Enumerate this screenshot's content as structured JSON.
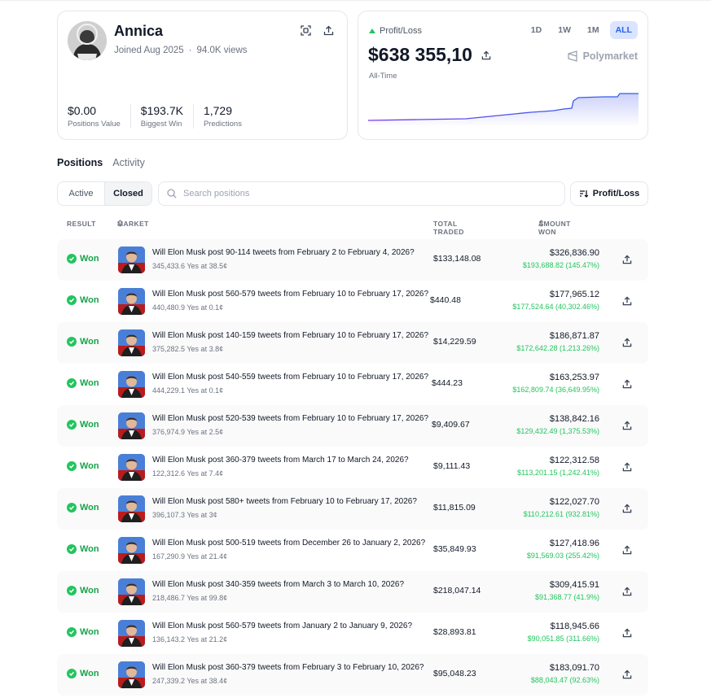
{
  "profile": {
    "name": "Annica",
    "joined": "Joined Aug 2025",
    "views": "94.0K views",
    "stats": [
      {
        "value": "$0.00",
        "label": "Positions Value"
      },
      {
        "value": "$193.7K",
        "label": "Biggest Win"
      },
      {
        "value": "1,729",
        "label": "Predictions"
      }
    ]
  },
  "pnl": {
    "label": "Profit/Loss",
    "value": "$638 355,10",
    "period_label": "All-Time",
    "brand": "Polymarket",
    "ranges": [
      "1D",
      "1W",
      "1M",
      "ALL"
    ],
    "active_range": "ALL",
    "colors": {
      "line": "#2563eb",
      "line_start": "#7c3aed",
      "up": "#22c55e"
    }
  },
  "tabs": {
    "positions": "Positions",
    "activity": "Activity"
  },
  "filter": {
    "active": "Active",
    "closed": "Closed"
  },
  "search": {
    "placeholder": "Search positions"
  },
  "sort": {
    "label": "Profit/Loss"
  },
  "columns": {
    "result": "RESULT",
    "market": "MARKET",
    "total_traded": "TOTAL TRADED",
    "amount_won": "AMOUNT WON"
  },
  "positions": [
    {
      "result": "Won",
      "title": "Will Elon Musk post 90-114 tweets from February 2 to February 4, 2026?",
      "sub": "345,433.6 Yes at 38.5¢",
      "traded": "$133,148.08",
      "amount": "$326,836.90",
      "pnl": "$193,688.82 (145.47%)"
    },
    {
      "result": "Won",
      "title": "Will Elon Musk post 560-579 tweets from February 10 to February 17, 2026?",
      "sub": "440,480.9 Yes at 0.1¢",
      "traded": "$440.48",
      "amount": "$177,965.12",
      "pnl": "$177,524.64 (40,302.46%)"
    },
    {
      "result": "Won",
      "title": "Will Elon Musk post 140-159 tweets from February 10 to February 17, 2026?",
      "sub": "375,282.5 Yes at 3.8¢",
      "traded": "$14,229.59",
      "amount": "$186,871.87",
      "pnl": "$172,642.28 (1,213.26%)"
    },
    {
      "result": "Won",
      "title": "Will Elon Musk post 540-559 tweets from February 10 to February 17, 2026?",
      "sub": "444,229.1 Yes at 0.1¢",
      "traded": "$444.23",
      "amount": "$163,253.97",
      "pnl": "$162,809.74 (36,649.95%)"
    },
    {
      "result": "Won",
      "title": "Will Elon Musk post 520-539 tweets from February 10 to February 17, 2026?",
      "sub": "376,974.9 Yes at 2.5¢",
      "traded": "$9,409.67",
      "amount": "$138,842.16",
      "pnl": "$129,432.49 (1,375.53%)"
    },
    {
      "result": "Won",
      "title": "Will Elon Musk post 360-379 tweets from March 17 to March 24, 2026?",
      "sub": "122,312.6 Yes at 7.4¢",
      "traded": "$9,111.43",
      "amount": "$122,312.58",
      "pnl": "$113,201.15 (1,242.41%)"
    },
    {
      "result": "Won",
      "title": "Will Elon Musk post 580+ tweets from February 10 to February 17, 2026?",
      "sub": "396,107.3 Yes at 3¢",
      "traded": "$11,815.09",
      "amount": "$122,027.70",
      "pnl": "$110,212.61 (932.81%)"
    },
    {
      "result": "Won",
      "title": "Will Elon Musk post 500-519 tweets from December 26 to January 2, 2026?",
      "sub": "167,290.9 Yes at 21.4¢",
      "traded": "$35,849.93",
      "amount": "$127,418.96",
      "pnl": "$91,569.03 (255.42%)"
    },
    {
      "result": "Won",
      "title": "Will Elon Musk post 340-359 tweets from March 3 to March 10, 2026?",
      "sub": "218,486.7 Yes at 99.8¢",
      "traded": "$218,047.14",
      "amount": "$309,415.91",
      "pnl": "$91,368.77 (41.9%)"
    },
    {
      "result": "Won",
      "title": "Will Elon Musk post 560-579 tweets from January 2 to January 9, 2026?",
      "sub": "136,143.2 Yes at 21.2¢",
      "traded": "$28,893.81",
      "amount": "$118,945.66",
      "pnl": "$90,051.85 (311.66%)"
    },
    {
      "result": "Won",
      "title": "Will Elon Musk post 360-379 tweets from February 3 to February 10, 2026?",
      "sub": "247,339.2 Yes at 38.4¢",
      "traded": "$95,048.23",
      "amount": "$183,091.70",
      "pnl": "$88,043.47 (92.63%)"
    }
  ]
}
